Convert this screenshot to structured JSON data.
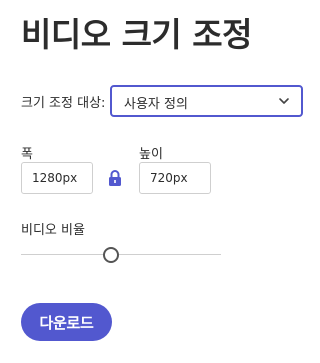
{
  "title": "비디오 크기 조정",
  "preset": {
    "label": "크기 조정 대상:",
    "selected": "사용자 정의"
  },
  "width": {
    "label": "폭",
    "value": "1280px"
  },
  "height": {
    "label": "높이",
    "value": "720px"
  },
  "aspect_lock": {
    "icon": "lock-icon",
    "locked": true
  },
  "ratio": {
    "label": "비디오 비율",
    "value": 0.45
  },
  "download": {
    "label": "다운로드"
  },
  "colors": {
    "accent": "#5258cf",
    "text": "#2c2c2c",
    "border": "#cfcfcf"
  }
}
